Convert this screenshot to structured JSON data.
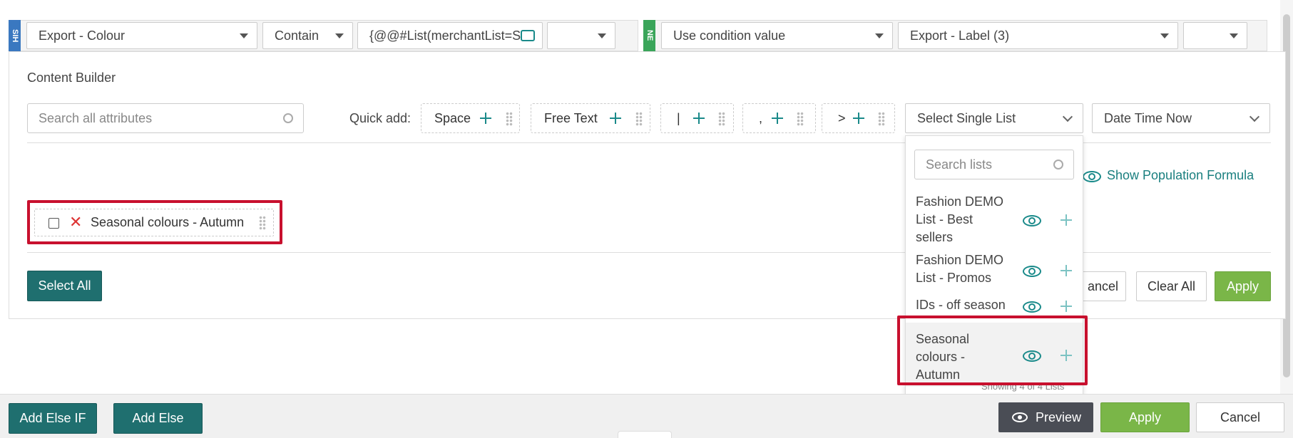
{
  "condition": {
    "if_tag": "SIH",
    "then_tag": "NE",
    "attribute": "Export - Colour",
    "operator": "Contain",
    "value_text": "{@@#List(merchantList=S",
    "action": "Use condition value",
    "target": "Export - Label (3)"
  },
  "builder": {
    "title": "Content Builder",
    "search_placeholder": "Search all attributes",
    "quick_add_label": "Quick add:",
    "quick_add": [
      "Space",
      "Free Text",
      "|",
      ",",
      ">"
    ],
    "select_single_list": "Select Single List",
    "date_time": "Date Time Now",
    "show_formula": "Show Population Formula",
    "chip_label": "Seasonal colours - Autumn",
    "select_all": "Select All",
    "cancel_partial": "ancel",
    "clear_all": "Clear All",
    "apply": "Apply"
  },
  "dropdown": {
    "search_placeholder": "Search lists",
    "items": [
      {
        "l1": "Fashion DEMO",
        "l2": "List - Best",
        "l3": "sellers"
      },
      {
        "l1": "Fashion DEMO",
        "l2": "List - Promos",
        "l3": ""
      },
      {
        "l1": "IDs - off season",
        "l2": "",
        "l3": ""
      },
      {
        "l1": "Seasonal",
        "l2": "colours -",
        "l3": "Autumn"
      }
    ],
    "footer": "Showing 4 of 4 Lists"
  },
  "footer": {
    "add_else_if": "Add Else IF",
    "add_else": "Add Else",
    "preview": "Preview",
    "apply": "Apply",
    "cancel": "Cancel"
  },
  "colors": {
    "teal": "#1f6f6f",
    "green": "#7ab648",
    "highlight": "#c8102e"
  }
}
